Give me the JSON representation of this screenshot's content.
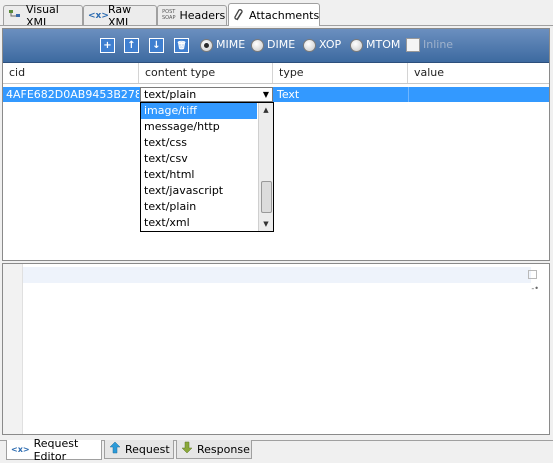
{
  "tabs": [
    {
      "label": "Visual XML",
      "icon": "tree-icon"
    },
    {
      "label": "Raw XML",
      "icon": "code-icon"
    },
    {
      "label": "Headers",
      "icon": "post-soap-icon",
      "icon_text_1": "POST",
      "icon_text_2": "SOAP"
    },
    {
      "label": "Attachments",
      "icon": "paperclip-icon",
      "active": true
    }
  ],
  "toolbar": {
    "buttons": [
      {
        "name": "add",
        "glyph": "+"
      },
      {
        "name": "move-up",
        "glyph": "↑"
      },
      {
        "name": "move-down",
        "glyph": "↓"
      },
      {
        "name": "delete",
        "glyph": "🗑"
      }
    ],
    "modes": [
      "MIME",
      "DIME",
      "XOP",
      "MTOM"
    ],
    "selected_mode": "MIME",
    "checkbox_label": "Inline",
    "checkbox_checked": false
  },
  "table": {
    "columns": [
      "cid",
      "content type",
      "type",
      "value"
    ],
    "rows": [
      {
        "cid": "4AFE682D0AB9453B278...",
        "content_type": "text/plain",
        "type": "Text",
        "value": ""
      }
    ]
  },
  "dropdown": {
    "options": [
      "image/tiff",
      "message/http",
      "text/css",
      "text/csv",
      "text/html",
      "text/javascript",
      "text/plain",
      "text/xml"
    ],
    "highlighted": "image/tiff"
  },
  "bottom_tabs": [
    {
      "label": "Request Editor",
      "icon": "code-icon",
      "active": true
    },
    {
      "label": "Request",
      "icon": "arrow-up-icon"
    },
    {
      "label": "Response",
      "icon": "arrow-down-icon"
    }
  ],
  "colors": {
    "toolbar": "#4a75a8",
    "selection": "#3399ff"
  }
}
